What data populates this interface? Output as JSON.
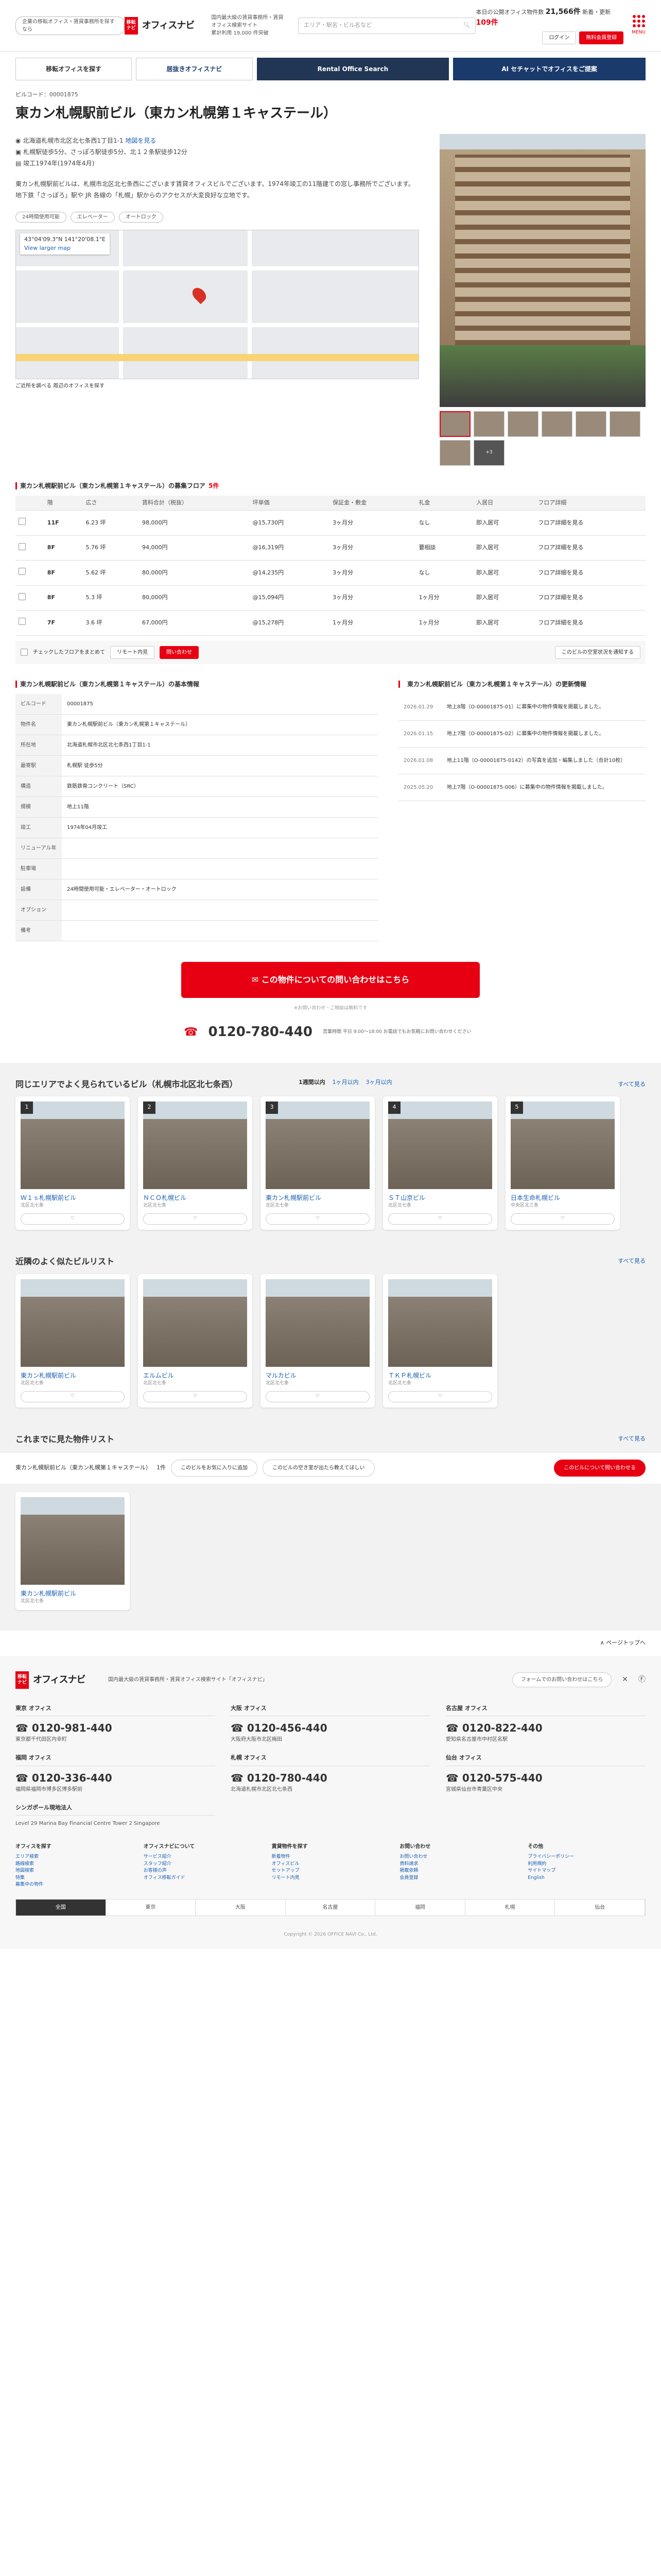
{
  "header": {
    "tagline": "企業の移転オフィス・賃貸事務所を探すなら",
    "logo": "オフィスナビ",
    "mid1": "国内最大級の賃貸事務所・賃貸オフィス検索サイト",
    "mid2": "累計利用 19,000 件突破",
    "search_placeholder": "エリア・駅名・ビル名など",
    "stat_label": "本日の公開オフィス物件数",
    "stat_val": "21,566件",
    "stat_new": "新着・更新",
    "stat_new_val": "109件",
    "login": "ログイン",
    "register": "無料会員登録",
    "menu": "MENU"
  },
  "banners": [
    "移転オフィスを探す",
    "居抜きオフィスナビ",
    "Rental Office Search",
    "AI セチャットでオフィスをご提案"
  ],
  "breadcrumb": "ビルコード：00001875",
  "title": "東カン札幌駅前ビル（東カン札幌第１キャステール）",
  "info": {
    "address": "北海道札幌市北区北七条西1丁目1-1",
    "map_link": "地図を見る",
    "station": "札幌駅徒歩5分、さっぽろ駅徒歩5分、北１２条駅徒歩12分",
    "built": "竣工1974年(1974年4月)"
  },
  "desc": "東カン札幌駅前ビルは、札幌市北区北七条西にございます賃貸オフィスビルでございます。1974年竣工の11階建ての窓し事務所でございます。地下鉄「さっぽろ」駅や JR 各線の「札幌」駅からのアクセスが大変良好な立地です。",
  "tags": [
    "24時間使用可能",
    "エレベーター",
    "オートロック"
  ],
  "map": {
    "coord": "43°04'09.3\"N 141°20'08.1\"E",
    "link": "View larger map"
  },
  "map_links": "ご近所を調べる  周辺のオフィスを探す",
  "vacant": {
    "title": "東カン札幌駅前ビル（東カン札幌第１キャステール）の募集フロア",
    "count": "5件",
    "headers": [
      "階",
      "広さ",
      "賃料合計（税抜）",
      "坪単価",
      "保証金・敷金",
      "礼金",
      "入居日",
      "フロア詳細"
    ],
    "rows": [
      [
        "11F",
        "6.23 坪",
        "98,000円",
        "@15,730円",
        "3ヶ月分",
        "なし",
        "即入居可",
        "フロア詳細を見る"
      ],
      [
        "8F",
        "5.76 坪",
        "94,000円",
        "@16,319円",
        "3ヶ月分",
        "要相談",
        "即入居可",
        "フロア詳細を見る"
      ],
      [
        "8F",
        "5.62 坪",
        "80,000円",
        "@14,235円",
        "3ヶ月分",
        "なし",
        "即入居可",
        "フロア詳細を見る"
      ],
      [
        "8F",
        "5.3 坪",
        "80,000円",
        "@15,094円",
        "3ヶ月分",
        "1ヶ月分",
        "即入居可",
        "フロア詳細を見る"
      ],
      [
        "7F",
        "3.6 坪",
        "67,000円",
        "@15,278円",
        "1ヶ月分",
        "1ヶ月分",
        "即入居可",
        "フロア詳細を見る"
      ]
    ],
    "foot": "チェックしたフロアをまとめて",
    "foot_btn1": "リモート内見",
    "foot_btn2": "問い合わせ",
    "foot_right": "このビルの空室状況を通知する"
  },
  "basic": {
    "title": "東カン札幌駅前ビル（東カン札幌第１キャステール）の基本情報",
    "rows": [
      [
        "ビルコード",
        "00001875"
      ],
      [
        "物件名",
        "東カン札幌駅前ビル（東カン札幌第１キャステール）"
      ],
      [
        "所在地",
        "北海道札幌市北区北七条西1丁目1-1"
      ],
      [
        "最寄駅",
        "札幌駅 徒歩5分"
      ],
      [
        "構造",
        "鉄筋鉄骨コンクリート（SRC）"
      ],
      [
        "規模",
        "地上11階"
      ],
      [
        "竣工",
        "1974年04月竣工"
      ],
      [
        "リニューアル年",
        ""
      ],
      [
        "駐車場",
        ""
      ],
      [
        "設備",
        "24時間使用可能・エレベーター・オートロック"
      ],
      [
        "オプション",
        ""
      ],
      [
        "備考",
        ""
      ]
    ]
  },
  "history": {
    "title": "東カン札幌駅前ビル（東カン札幌第１キャステール）の更新情報",
    "rows": [
      [
        "2026.01.29",
        "地上8階（O-00001875-01）に募集中の物件情報を掲載しました。"
      ],
      [
        "2026.01.15",
        "地上7階（O-00001875-02）に募集中の物件情報を掲載しました。"
      ],
      [
        "2026.01.08",
        "地上11階（O-00001875-0142）の写真を追加・編集しました（合計10枚）"
      ],
      [
        "2025.05.20",
        "地上7階（O-00001875-006）に募集中の物件情報を掲載しました。"
      ]
    ]
  },
  "cta": {
    "label": "この物件についての問い合わせはこちら",
    "note": "※お問い合わせ・ご相談は無料です",
    "phone": "0120-780-440",
    "phone_note": "営業時間 平日 9:00〜18:00 お電話でもお気軽にお問い合わせください"
  },
  "similar": {
    "title": "同じエリアでよく見られているビル（札幌市北区北七条西）",
    "more": "すべて見る",
    "tabs": [
      "1週間以内",
      "1ヶ月以内",
      "3ヶ月以内"
    ],
    "cards": [
      [
        "1",
        "Ｗ１ｓ札幌駅前ビル",
        "北区北七条"
      ],
      [
        "2",
        "ＮＣＯ札幌ビル",
        "北区北七条"
      ],
      [
        "3",
        "東カン札幌駅前ビル",
        "北区北七条"
      ],
      [
        "4",
        "ＳＴ山京ビル",
        "北区北七条"
      ],
      [
        "5",
        "日本生命札幌ビル",
        "中央区北三条"
      ]
    ]
  },
  "nearby": {
    "title": "近隣のよく似たビルリスト",
    "more": "すべて見る",
    "cards": [
      [
        "",
        "東カン札幌駅前ビル",
        "北区北七条"
      ],
      [
        "",
        "エルムビル",
        "北区北七条"
      ],
      [
        "",
        "マルカビル",
        "北区北七条"
      ],
      [
        "",
        "ＴＫＰ札幌ビル",
        "北区北七条"
      ]
    ]
  },
  "recent": {
    "title": "これまでに見た物件リスト",
    "more": "すべて見る",
    "bar_title": "東カン札幌駅前ビル（東カン札幌第１キャステール）",
    "bar_count": "1件",
    "bar_b1": "このビルをお気に入りに追加",
    "bar_b2": "このビルの空き室が出たら教えてほしい",
    "bar_b3": "このビルについて問い合わせる",
    "card": [
      "",
      "東カン札幌駅前ビル",
      "北区北七条"
    ]
  },
  "pagetop": "ページトップへ",
  "footer": {
    "company": "国内最大級の賃貸事務所・賃貸オフィス検索サイト「オフィスナビ」",
    "form": "フォームでのお問い合わせはこちら",
    "offices": [
      [
        "東京 オフィス",
        "0120-981-440",
        "東京都千代田区内幸町"
      ],
      [
        "大阪 オフィス",
        "0120-456-440",
        "大阪府大阪市北区梅田"
      ],
      [
        "名古屋 オフィス",
        "0120-822-440",
        "愛知県名古屋市中村区名駅"
      ],
      [
        "福岡 オフィス",
        "0120-336-440",
        "福岡県福岡市博多区博多駅前"
      ],
      [
        "札幌 オフィス",
        "0120-780-440",
        "北海道札幌市北区北七条西"
      ],
      [
        "仙台 オフィス",
        "0120-575-440",
        "宮城県仙台市青葉区中央"
      ],
      [
        "シンガポール現地法人",
        "",
        "Level 29 Marina Bay Financial Centre Tower 2 Singapore"
      ]
    ],
    "cols": [
      [
        "オフィスを探す",
        "エリア検索",
        "路線検索",
        "地図検索",
        "特集",
        "募集中の物件"
      ],
      [
        "オフィスナビについて",
        "サービス紹介",
        "スタッフ紹介",
        "お客様の声",
        "オフィス移転ガイド"
      ],
      [
        "賃貸物件を探す",
        "新着物件",
        "オフィスビル",
        "セットアップ",
        "リモート内見"
      ],
      [
        "お問い合わせ",
        "お問い合わせ",
        "資料請求",
        "掲載依頼",
        "会員登録"
      ],
      [
        "その他",
        "プライバシーポリシー",
        "利用規約",
        "サイトマップ",
        "English"
      ]
    ],
    "areas": [
      "全国",
      "東京",
      "大阪",
      "名古屋",
      "福岡",
      "札幌",
      "仙台"
    ],
    "copyright": "Copyright © 2026 OFFICE NAVI Co., Ltd."
  }
}
